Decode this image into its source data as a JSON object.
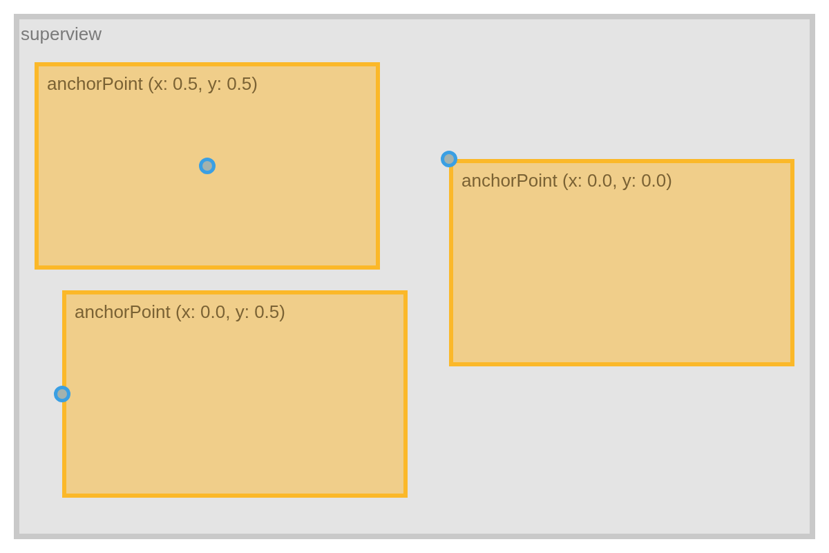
{
  "superview": {
    "label": "superview"
  },
  "views": [
    {
      "label": "anchorPoint (x: 0.5, y: 0.5)",
      "kind": "center"
    },
    {
      "label": "anchorPoint (x: 0.0, y: 0.0)",
      "kind": "topleft"
    },
    {
      "label": "anchorPoint (x: 0.0, y: 0.5)",
      "kind": "leftmid"
    }
  ]
}
